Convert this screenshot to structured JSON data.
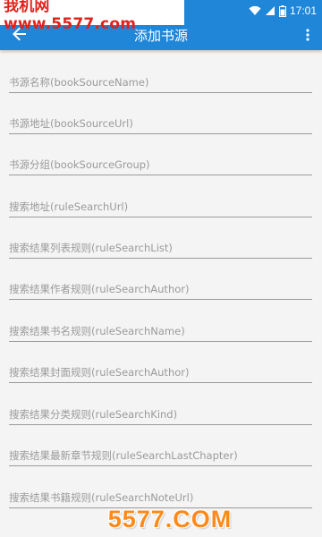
{
  "status_bar": {
    "time": "17:01",
    "icons": [
      "wifi-icon",
      "signal-icon",
      "battery-icon"
    ]
  },
  "watermark": {
    "top_text": "我机网 www.5577.com",
    "bottom_text": "5577.COM"
  },
  "app_bar": {
    "title": "添加书源",
    "back_icon": "arrow-left-icon",
    "menu_icon": "more-vertical-icon"
  },
  "colors": {
    "primary": "#1f86d8",
    "background": "#f4f4f4",
    "hint_text": "#9a9a9a",
    "watermark_red": "#e0221b",
    "watermark_orange": "#ff8a1a"
  },
  "form": {
    "fields": [
      {
        "placeholder": "书源名称(bookSourceName)",
        "value": ""
      },
      {
        "placeholder": "书源地址(bookSourceUrl)",
        "value": ""
      },
      {
        "placeholder": "书源分组(bookSourceGroup)",
        "value": ""
      },
      {
        "placeholder": "搜索地址(ruleSearchUrl)",
        "value": ""
      },
      {
        "placeholder": "搜索结果列表规则(ruleSearchList)",
        "value": ""
      },
      {
        "placeholder": "搜索结果作者规则(ruleSearchAuthor)",
        "value": ""
      },
      {
        "placeholder": "搜索结果书名规则(ruleSearchName)",
        "value": ""
      },
      {
        "placeholder": "搜索结果封面规则(ruleSearchAuthor)",
        "value": ""
      },
      {
        "placeholder": "搜索结果分类规则(ruleSearchKind)",
        "value": ""
      },
      {
        "placeholder": "搜索结果最新章节规则(ruleSearchLastChapter)",
        "value": ""
      },
      {
        "placeholder": "搜索结果书籍规则(ruleSearchNoteUrl)",
        "value": ""
      }
    ]
  }
}
